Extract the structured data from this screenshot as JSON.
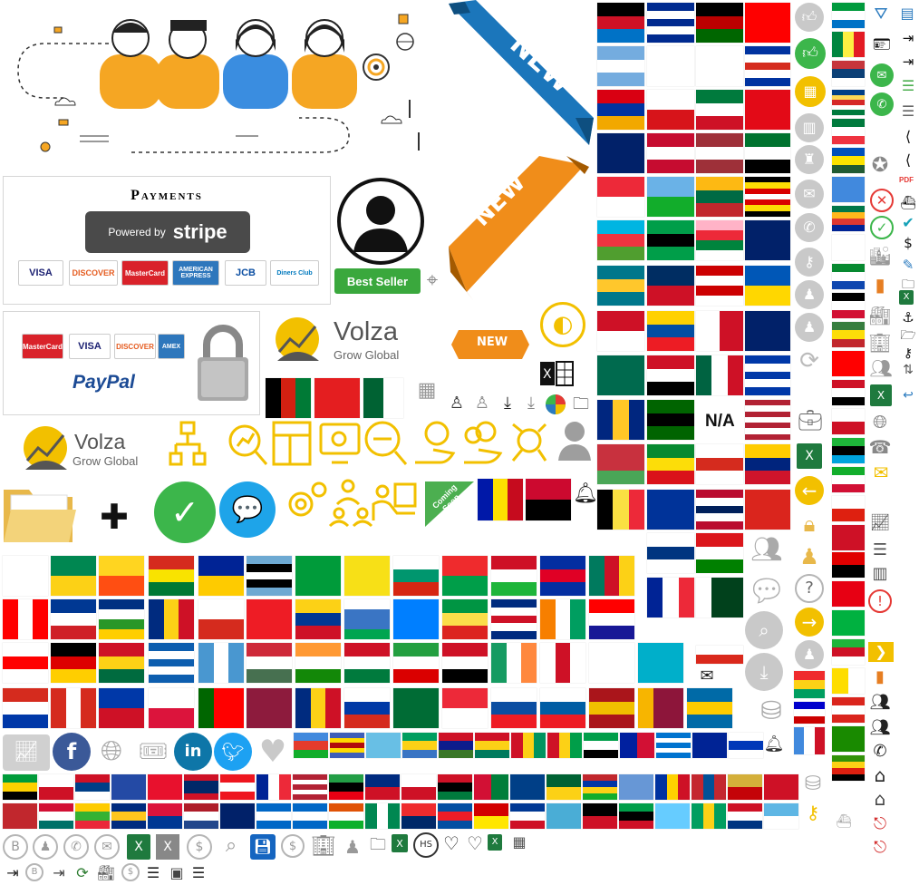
{
  "payments_box": {
    "title": "Payments",
    "stripe_prefix": "Powered by",
    "stripe_brand": "stripe",
    "cards": [
      "VISA",
      "DISCOVER",
      "MasterCard",
      "AMERICAN EXPRESS",
      "JCB",
      "Diners Club"
    ]
  },
  "paypal_box": {
    "cards": [
      "MasterCard",
      "VISA",
      "DISCOVER",
      "AMEX"
    ],
    "brand": "PayPal"
  },
  "best_seller": {
    "label": "Best Seller"
  },
  "ribbons": {
    "blue": "NEW",
    "orange": "NEW",
    "small": "NEW"
  },
  "volza_logo": {
    "name": "Volza",
    "tagline": "Grow Global"
  },
  "coming_soon": "Coming Soon",
  "na_label": "N/A",
  "misc_text": {
    "hs_badge": "HS",
    "pdf": "PDF"
  }
}
